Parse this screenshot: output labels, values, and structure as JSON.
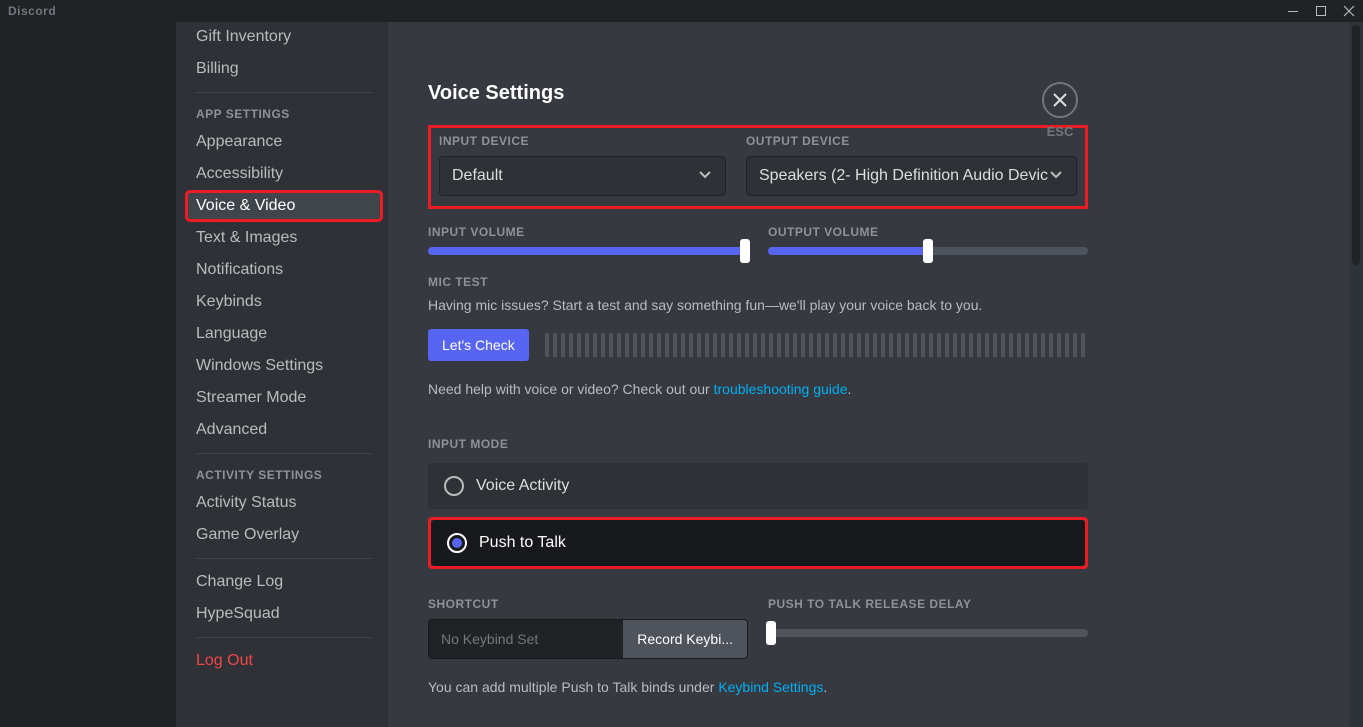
{
  "app_name": "Discord",
  "sidebar": {
    "items_top": [
      {
        "label": "Gift Inventory"
      },
      {
        "label": "Billing"
      }
    ],
    "app_settings_header": "APP SETTINGS",
    "app_settings": [
      {
        "label": "Appearance"
      },
      {
        "label": "Accessibility"
      },
      {
        "label": "Voice & Video",
        "active": true
      },
      {
        "label": "Text & Images"
      },
      {
        "label": "Notifications"
      },
      {
        "label": "Keybinds"
      },
      {
        "label": "Language"
      },
      {
        "label": "Windows Settings"
      },
      {
        "label": "Streamer Mode"
      },
      {
        "label": "Advanced"
      }
    ],
    "activity_header": "ACTIVITY SETTINGS",
    "activity_settings": [
      {
        "label": "Activity Status"
      },
      {
        "label": "Game Overlay"
      }
    ],
    "misc": [
      {
        "label": "Change Log"
      },
      {
        "label": "HypeSquad"
      }
    ],
    "logout": "Log Out"
  },
  "content": {
    "title": "Voice Settings",
    "esc_label": "ESC",
    "input_device_label": "INPUT DEVICE",
    "input_device_value": "Default",
    "output_device_label": "OUTPUT DEVICE",
    "output_device_value": "Speakers (2- High Definition Audio Devic",
    "input_volume_label": "INPUT VOLUME",
    "input_volume_percent": 100,
    "output_volume_label": "OUTPUT VOLUME",
    "output_volume_percent": 50,
    "mic_test_label": "MIC TEST",
    "mic_test_desc": "Having mic issues? Start a test and say something fun—we'll play your voice back to you.",
    "mic_test_button": "Let's Check",
    "help_text_1": "Need help with voice or video? Check out our ",
    "help_link": "troubleshooting guide",
    "help_text_2": ".",
    "input_mode_label": "INPUT MODE",
    "input_mode_options": [
      {
        "label": "Voice Activity",
        "selected": false
      },
      {
        "label": "Push to Talk",
        "selected": true
      }
    ],
    "shortcut_label": "SHORTCUT",
    "shortcut_placeholder": "No Keybind Set",
    "shortcut_button": "Record Keybi...",
    "ptt_delay_label": "PUSH TO TALK RELEASE DELAY",
    "ptt_delay_percent": 0,
    "footnote_1": "You can add multiple Push to Talk binds under ",
    "footnote_link": "Keybind Settings",
    "footnote_2": "."
  }
}
